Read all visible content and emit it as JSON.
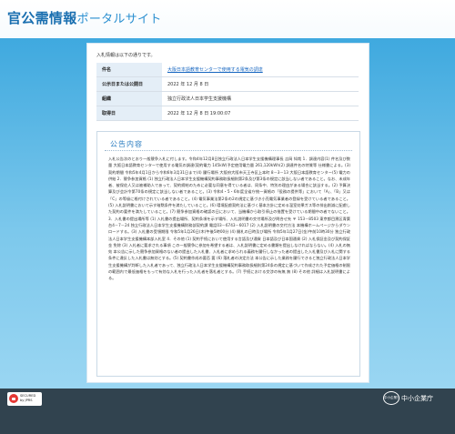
{
  "header": {
    "title_strong": "官公需情報",
    "title_light": "ポータルサイト"
  },
  "notice_panel": {
    "intro": "入札情報は以下の通りです。",
    "rows": [
      {
        "key": "件名",
        "value": "大阪日本語教育センターで使用する電気の調達",
        "is_link": true
      },
      {
        "key": "公示日または公開日",
        "value": "2022 年 12 月 8 日",
        "is_link": false
      },
      {
        "key": "組織",
        "value": "独立行政法人日本学生支援機構",
        "is_link": false
      },
      {
        "key": "取得日",
        "value": "2022 年 12 月 8 日 19:00:07",
        "is_link": false
      }
    ],
    "section_title": "公告内容",
    "body": "入札公告次のとおり一般競争入札に付します。令和4年12月8日独立行政法人日本学生支援機構理事長 吉岡 知哉 1．調達内容(1) 件名及び数量 大阪日本語教育センターで使用する電気の調達(契約電力 145kW)予定使用電力量 261,120kWh(2) 調達件名の特質等 仕様書による。(3) 契約期間 令和5年4月1日から令和6年3月31日まで(4) 履行場所 大阪府大阪市天王寺区上本町 8－3－13 大阪日本語教育センター(5) 電力の供給 2．競争参加資格 (1) 独立行政法人日本学生支援機構契約事務取扱細則第2条及び第3条の規定に該当しない者であること。なお、未成年者、被保佐人又は被補助人であって、契約締結のために必要な同意を得ている者は、同条中、特別の理由がある場合に該当する。(2) 予算決算及び会計令第70条の規定に該当しない者であること。(3) 令和4・5・6年度全省庁統一資格の「役務の提供等」において「A」、「B」又は「C」の等級に格付けされている者であること。(4) 電気事業法第2条の2の規定に基づき小売電気事業者の登録を受けている者であること。(5) 入札説明書において示す暗黙条件を満たしていること。(6) 環境配慮契約法に基づく基本方針に定める温室効果ガス等の排出削減に配慮した契約の要件を満たしていること。(7) 競争参加資格の確認の日において、当機構から取引停止の措置を受けている期間中の者でないこと。3．入札書の提出場所等 (1) 入札書の提出場所、契約条項を示す場所、入札説明書の交付場所及び問合せ先 〒 153－8503 東京都目黒区青葉台4－7－24 独立行政法人日本学生支援機構財務部契約課 電話03－6743－6017 (2) 入札説明書の交付方法 本機構ホームページからダウンロードする。(3) 入札書の受領期限 令和5年1月26日(木)午後5時00分 (4) 開札の日時及び場所 令和5年1月27日(金)午前10時30分 独立行政法人日本学生支援機構本部入札室 4．その他 (1) 契約手続において使用する言語及び通貨 日本語及び日本国通貨 (2) 入札保証金及び契約保証金 免除 (3) 入札者に要求される事項 この一般競争に参加を希望する者は、入札説明書に定める書類を提出しなければならない。(4) 入札の無効 本公告に示した競争参加資格のない者の提出した入札書、入札者に求められる義務を履行しなかった者の提出した入札書及び入札に関する条件に違反した入札書は無効とする。(5) 契約書作成の要否 要 (6) 落札者の決定方法 本公告に示した業務を履行できると独立行政法人日本学生支援機構が判断した入札者であって、独立行政法人日本学生支援機構契約事務取扱細則第24条の規定に基づいて作成された予定価格の制限の範囲内で最低価格をもって有効な入札を行った入札者を落札者とする。(7) 手続における交渉の有無 無 (8) その他 詳細は入札説明書による。"
  },
  "footer": {
    "secured_line1": "SECURED",
    "secured_line2": "by JPRS",
    "sme_emblem": "中小企業庁",
    "sme_name": "中小企業庁"
  },
  "colors": {
    "title_strong": "#1a6fb0",
    "band_top": "#3fa9df",
    "footer": "#31434f",
    "link": "#1565c0"
  }
}
